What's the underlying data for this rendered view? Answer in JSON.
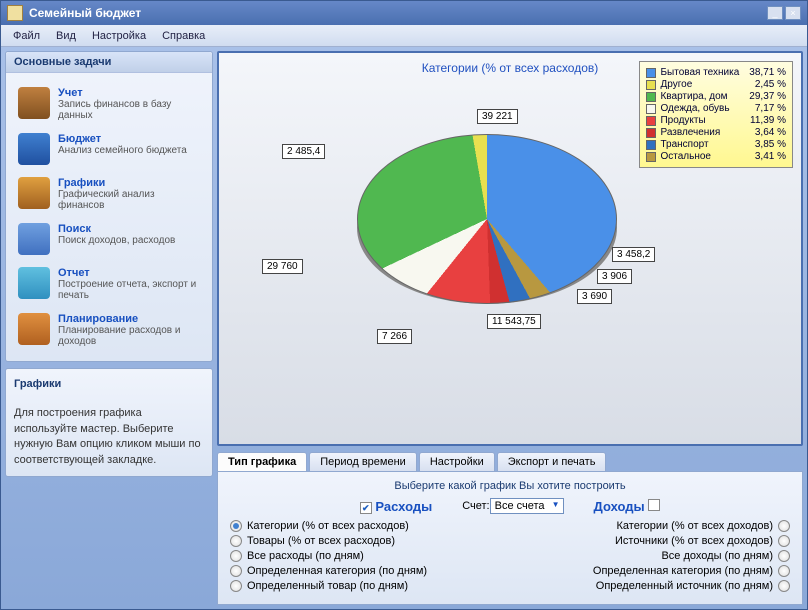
{
  "window": {
    "title": "Семейный бюджет"
  },
  "menu": {
    "file": "Файл",
    "view": "Вид",
    "settings": "Настройка",
    "help": "Справка"
  },
  "sidebar": {
    "header": "Основные задачи",
    "items": [
      {
        "title": "Учет",
        "desc": "Запись финансов в базу данных"
      },
      {
        "title": "Бюджет",
        "desc": "Анализ семейного бюджета"
      },
      {
        "title": "Графики",
        "desc": "Графический анализ финансов"
      },
      {
        "title": "Поиск",
        "desc": "Поиск доходов, расходов"
      },
      {
        "title": "Отчет",
        "desc": "Построение отчета, экспорт и печать"
      },
      {
        "title": "Планирование",
        "desc": "Планирование расходов и доходов"
      }
    ]
  },
  "help": {
    "title": "Графики",
    "text": "Для построения графика используйте мастер. Выберите нужную Вам опцию кликом мыши по соответствующей закладке."
  },
  "chart": {
    "title": "Категории (% от всех расходов)"
  },
  "chart_data": {
    "type": "pie",
    "title": "Категории (% от всех расходов)",
    "series": [
      {
        "name": "Бытовая техника",
        "percent": 38.71,
        "value": 39221,
        "color": "#4a90e8"
      },
      {
        "name": "Другое",
        "percent": 2.45,
        "value": 2485.4,
        "color": "#e8e050"
      },
      {
        "name": "Квартира, дом",
        "percent": 29.37,
        "value": 29760,
        "color": "#50b850"
      },
      {
        "name": "Одежда, обувь",
        "percent": 7.17,
        "value": 7266,
        "color": "#f8f8f0"
      },
      {
        "name": "Продукты",
        "percent": 11.39,
        "value": 11543.75,
        "color": "#e84040"
      },
      {
        "name": "Развлечения",
        "percent": 3.64,
        "value": 3690,
        "color": "#d03030"
      },
      {
        "name": "Транспорт",
        "percent": 3.85,
        "value": 3906,
        "color": "#3070c0"
      },
      {
        "name": "Остальное",
        "percent": 3.41,
        "value": 3458.2,
        "color": "#b89840"
      }
    ]
  },
  "callouts": {
    "c0": "39 221",
    "c1": "2 485,4",
    "c2": "29 760",
    "c3": "7 266",
    "c4": "11 543,75",
    "c5": "3 690",
    "c6": "3 906",
    "c7": "3 458,2"
  },
  "legend_pct": {
    "p0": "38,71 %",
    "p1": "2,45 %",
    "p2": "29,37 %",
    "p3": "7,17 %",
    "p4": "11,39 %",
    "p5": "3,64 %",
    "p6": "3,85 %",
    "p7": "3,41 %"
  },
  "tabs": {
    "t0": "Тип графика",
    "t1": "Период времени",
    "t2": "Настройки",
    "t3": "Экспорт и печать"
  },
  "options": {
    "title": "Выберите какой график Вы хотите построить",
    "expenses": "Расходы",
    "incomes": "Доходы",
    "account_label": "Счет:",
    "account_value": "Все счета",
    "exp_radios": {
      "r0": "Категории (% от всех расходов)",
      "r1": "Товары (% от всех расходов)",
      "r2": "Все расходы (по дням)",
      "r3": "Определенная категория (по дням)",
      "r4": "Определенный товар (по дням)"
    },
    "inc_radios": {
      "r0": "Категории (% от всех доходов)",
      "r1": "Источники (% от всех доходов)",
      "r2": "Все доходы (по дням)",
      "r3": "Определенная категория (по дням)",
      "r4": "Определенный источник (по дням)"
    }
  }
}
